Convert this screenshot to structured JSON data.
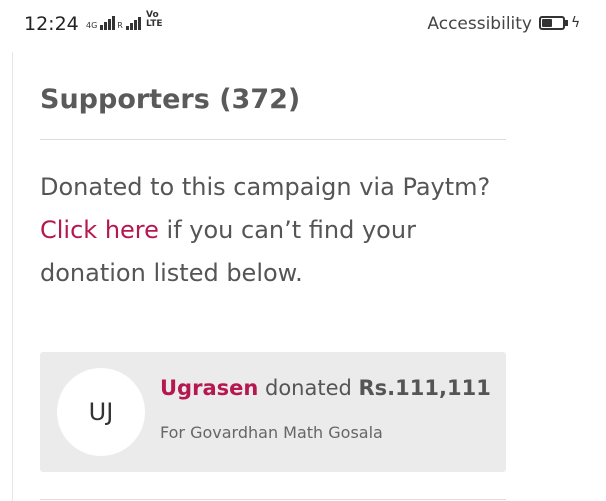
{
  "status_bar": {
    "time": "12:24",
    "network_label": "4G",
    "sim_label": "R",
    "volte_top": "Vo",
    "volte_bottom": "LTE",
    "accessibility": "Accessibility",
    "battery_level": 0.55
  },
  "supporters": {
    "title": "Supporters (372)",
    "intro_before": "Donated to this campaign via Paytm? ",
    "intro_link": "Click here",
    "intro_after": " if you can’t find your donation listed below."
  },
  "donations": [
    {
      "initials": "UJ",
      "name": "Ugrasen",
      "verb": " donated ",
      "amount": "Rs.111,111",
      "cause": "For Govardhan Math Gosala"
    }
  ],
  "colors": {
    "accent": "#b5174f",
    "text": "#555555",
    "card_bg": "#ebebeb"
  }
}
